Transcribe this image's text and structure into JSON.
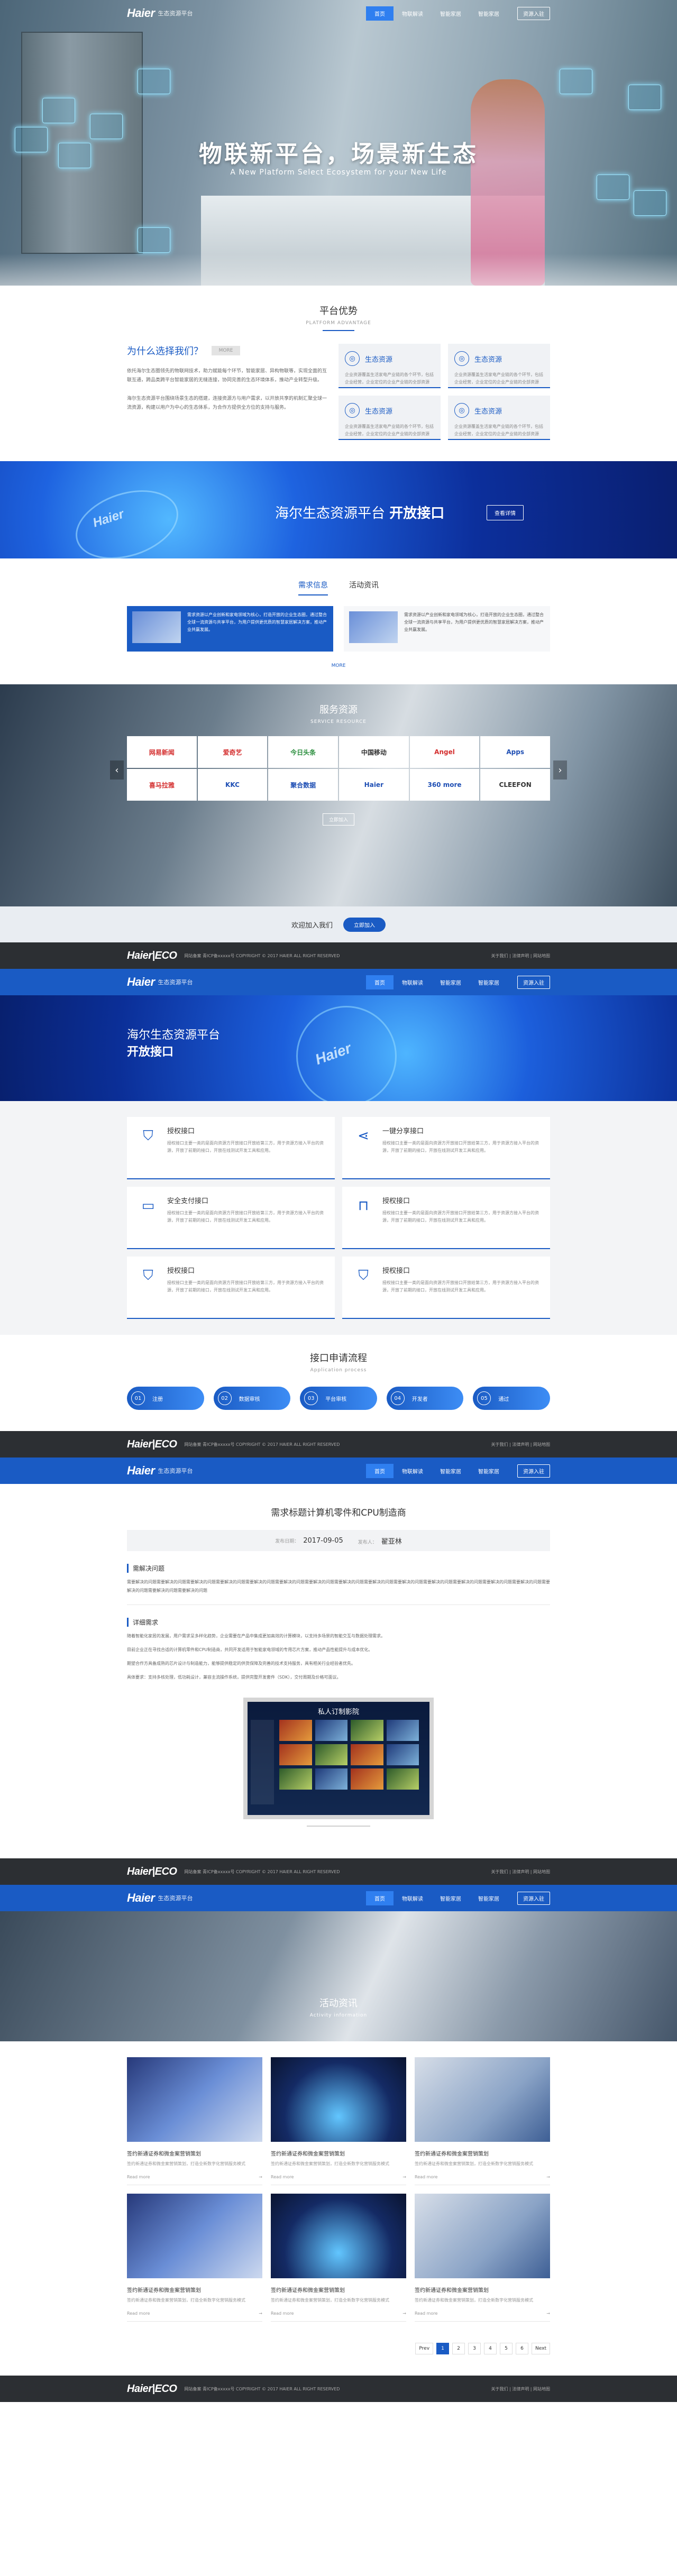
{
  "nav": {
    "logo": "Haier",
    "logo_sub": "生态资源平台",
    "menu": [
      "首页",
      "物联解读",
      "智能家居",
      "智能家居"
    ],
    "join": "资源入驻"
  },
  "hero": {
    "title": "物联新平台，场景新生态",
    "subtitle": "A New Platform Select Ecosystem for your New Life"
  },
  "advantages": {
    "title": "平台优势",
    "title_en": "PLATFORM ADVANTAGE",
    "why_title": "为什么选择我们？",
    "why_tag": "MORE",
    "why_text1": "依托海尔生态圈领先的物联网技术，助力赋能每个环节，智能家居、异构物联等，实现全面的互联互通，跨品类跨平台智能家居的无缝连接，协同完善的生态环境体系，推动产业转型升级。",
    "why_text2": "海尔生态资源平台围绕场景生态的搭建，连接资源方与用户需求，以开放共享的机制汇聚全球一流资源，构建以用户为中心的生态体系，为合作方提供全方位的支持与服务。",
    "cards": [
      {
        "title": "生态资源",
        "text": "企业资源覆盖生活家电产业链的各个环节，包括企业经营，企业定位的企业产业链的全部资源"
      },
      {
        "title": "生态资源",
        "text": "企业资源覆盖生活家电产业链的各个环节，包括企业经营，企业定位的企业产业链的全部资源"
      },
      {
        "title": "生态资源",
        "text": "企业资源覆盖生活家电产业链的各个环节，包括企业经营，企业定位的企业产业链的全部资源"
      },
      {
        "title": "生态资源",
        "text": "企业资源覆盖生活家电产业链的各个环节，包括企业经营，企业定位的企业产业链的全部资源"
      }
    ]
  },
  "banner": {
    "mark": "Haier",
    "text_a": "海尔生态资源平台",
    "text_b": "开放接口",
    "button": "查看详情"
  },
  "news": {
    "tabs": [
      "需求信息",
      "活动资讯"
    ],
    "items": [
      "需求资源以产业创新和家电领域为核心，打造开放的企业生态圈，通过整合全球一流资源与共享平台，为用户提供更优质的智慧家居解决方案，推动产业共赢发展。",
      "需求资源以产业创新和家电领域为核心，打造开放的企业生态圈，通过整合全球一流资源与共享平台，为用户提供更优质的智慧家居解决方案，推动产业共赢发展。"
    ],
    "more": "MORE"
  },
  "resources": {
    "title": "服务资源",
    "title_en": "SERVICE RESOURCE",
    "logos": [
      "网易新闻",
      "爱奇艺",
      "今日头条",
      "中国移动",
      "Angel",
      "Apps",
      "喜马拉雅",
      "KKC",
      "聚合数据",
      "Haier",
      "360 more",
      "CLEEFON"
    ],
    "join": "立即加入"
  },
  "welcome": {
    "text": "欢迎加入我们",
    "button": "立即加入"
  },
  "footer": {
    "logo": "Haier|ECO",
    "text": "网站备案 青ICP备xxxxx号  COPYRIGHT © 2017 HAIER ALL RIGHT RESERVED",
    "links": "关于我们 | 法律声明 | 网站地图"
  },
  "api_page": {
    "mark": "Haier",
    "title_a": "海尔生态资源平台",
    "title_b": "开放接口",
    "items": [
      {
        "title": "授权接口",
        "icon": "shield-check-icon",
        "text": "授权接口主要一类的是面向资源方开放接口开放给第三方，用于资源方接入平台的资源，开放了前期的接口，开放在线测试开发工具和应用。"
      },
      {
        "title": "一键分享接口",
        "icon": "share-icon",
        "text": "授权接口主要一类的是面向资源方开放接口开放给第三方，用于资源方接入平台的资源，开放了前期的接口，开放在线测试开发工具和应用。"
      },
      {
        "title": "安全支付接口",
        "icon": "card-icon",
        "text": "授权接口主要一类的是面向资源方开放接口开放给第三方，用于资源方接入平台的资源，开放了前期的接口，开放在线测试开发工具和应用。"
      },
      {
        "title": "授权接口",
        "icon": "lock-icon",
        "text": "授权接口主要一类的是面向资源方开放接口开放给第三方，用于资源方接入平台的资源，开放了前期的接口，开放在线测试开发工具和应用。"
      },
      {
        "title": "授权接口",
        "icon": "shield-check-icon",
        "text": "授权接口主要一类的是面向资源方开放接口开放给第三方，用于资源方接入平台的资源，开放了前期的接口，开放在线测试开发工具和应用。"
      },
      {
        "title": "授权接口",
        "icon": "shield-check-icon",
        "text": "授权接口主要一类的是面向资源方开放接口开放给第三方，用于资源方接入平台的资源，开放了前期的接口，开放在线测试开发工具和应用。"
      }
    ],
    "flow_title": "接口申请流程",
    "flow_title_en": "Application process",
    "steps": [
      {
        "n": "01",
        "label": "注册"
      },
      {
        "n": "02",
        "label": "数据审核"
      },
      {
        "n": "03",
        "label": "平台审核"
      },
      {
        "n": "04",
        "label": "开发者"
      },
      {
        "n": "05",
        "label": "通过"
      }
    ]
  },
  "detail": {
    "title": "需求标题计算机零件和CPU制造商",
    "date_label": "发布日期：",
    "date": "2017-09-05",
    "author_label": "发布人：",
    "author": "翟亚林",
    "sec1": "需解决问题",
    "sec1_text": "需要解决的问题需要解决的问题需要解决的问题需要解决的问题需要解决的问题需要解决的问题需要解决的问题需要解决的问题需要解决的问题需要解决的问题需要解决的问题需要解决的问题需要解决的问题需要解决的问题需要解决的问题需要解决的问题需要解决的问题",
    "sec2": "详细需求",
    "sec2_p1": "随着智能化家居的发展，用户需求呈多样化趋势，企业需要在产品中集成更加高效的计算模块，以支持多场景的智能交互与数据处理需求。",
    "sec2_p2": "目前企业正在寻找合适的计算机零件和CPU制造商，共同开发适用于智能家电领域的专用芯片方案，推动产品性能提升与成本优化。",
    "sec2_p3": "期望合作方具备成熟的芯片设计与制造能力，能够提供稳定的供货保障及完善的技术支持服务，具有相关行业经验者优先。",
    "sec2_p4": "具体要求：支持多核处理，低功耗设计，兼容主流操作系统，提供完整开发套件（SDK），交付周期及价格可面议。",
    "tv_title": "私人订制影院"
  },
  "activity": {
    "title": "活动资讯",
    "title_en": "Activity information",
    "items": [
      {
        "title": "签约新通证券和微金案营销策划",
        "desc": "签约新通证券和微金案营销策划，打造全新数字化营销服务模式",
        "link": "Read more"
      },
      {
        "title": "签约新通证券和微金案营销策划",
        "desc": "签约新通证券和微金案营销策划，打造全新数字化营销服务模式",
        "link": "Read more"
      },
      {
        "title": "签约新通证券和微金案营销策划",
        "desc": "签约新通证券和微金案营销策划，打造全新数字化营销服务模式",
        "link": "Read more"
      },
      {
        "title": "签约新通证券和微金案营销策划",
        "desc": "签约新通证券和微金案营销策划，打造全新数字化营销服务模式",
        "link": "Read more"
      },
      {
        "title": "签约新通证券和微金案营销策划",
        "desc": "签约新通证券和微金案营销策划，打造全新数字化营销服务模式",
        "link": "Read more"
      },
      {
        "title": "签约新通证券和微金案营销策划",
        "desc": "签约新通证券和微金案营销策划，打造全新数字化营销服务模式",
        "link": "Read more"
      }
    ],
    "pager": [
      "Prev",
      "1",
      "2",
      "3",
      "4",
      "5",
      "6",
      "Next"
    ]
  },
  "colors": {
    "accent": "#1a5bc4",
    "footer": "#2c2f33"
  }
}
